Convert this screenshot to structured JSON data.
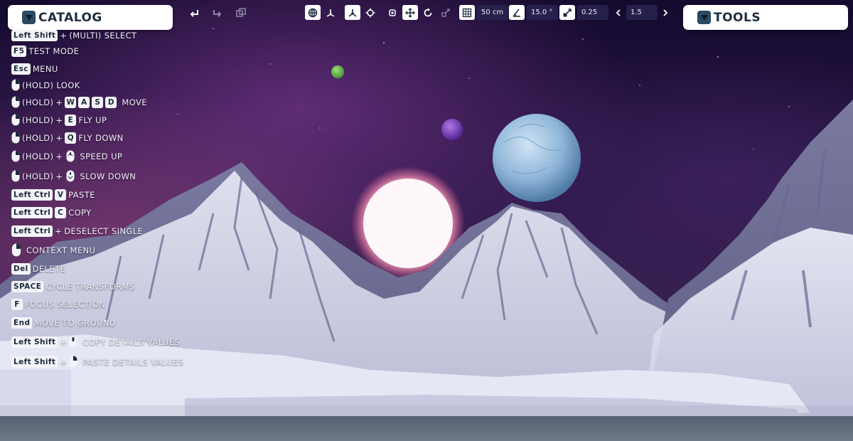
{
  "catalog": {
    "label": "CATALOG"
  },
  "tools": {
    "label": "TOOLS"
  },
  "toolbar": {
    "grid_value": "50 cm",
    "angle_value": "15.0 °",
    "scale_value": "0.25",
    "speed_value": "1.5"
  },
  "shortcuts": {
    "multi_select": {
      "key": "Left Shift",
      "text": "(MULTI) SELECT"
    },
    "test_mode": {
      "key": "F5",
      "text": "TEST MODE"
    },
    "menu": {
      "key": "Esc",
      "text": "MENU"
    },
    "look": {
      "text": "(HOLD) LOOK"
    },
    "move": {
      "hold": "(HOLD)",
      "keys": [
        "W",
        "A",
        "S",
        "D"
      ],
      "text": "MOVE"
    },
    "fly_up": {
      "hold": "(HOLD)",
      "key": "E",
      "text": "FLY UP"
    },
    "fly_down": {
      "hold": "(HOLD)",
      "key": "Q",
      "text": "FLY DOWN"
    },
    "speed_up": {
      "hold": "(HOLD)",
      "text": "SPEED UP"
    },
    "slow_down": {
      "hold": "(HOLD)",
      "text": "SLOW DOWN"
    },
    "paste": {
      "key": "Left Ctrl",
      "key2": "V",
      "text": "PASTE"
    },
    "copy": {
      "key": "Left Ctrl",
      "key2": "C",
      "text": "COPY"
    },
    "deselect": {
      "key": "Left Ctrl",
      "text": "DESELECT SINGLE"
    },
    "context": {
      "text": "CONTEXT MENU"
    },
    "delete": {
      "key": "Del",
      "text": "DELETE"
    },
    "cycle": {
      "key": "SPACE",
      "text": "CYCLE TRANSFORMS"
    },
    "focus": {
      "key": "F",
      "text": "FOCUS SELECTION"
    },
    "ground": {
      "key": "End",
      "text": "MOVE TO GROUND"
    },
    "copy_details": {
      "key": "Left Shift",
      "text": "COPY DETAILS VALUES"
    },
    "paste_details": {
      "key": "Left Shift",
      "text": "PASTE DETAILS VALUES"
    }
  },
  "plus": "+",
  "colors": {
    "panel": "#ffffff",
    "panel_text": "#1f2f3f",
    "logo": "#2c4a63",
    "field_bg": "#28244f"
  }
}
